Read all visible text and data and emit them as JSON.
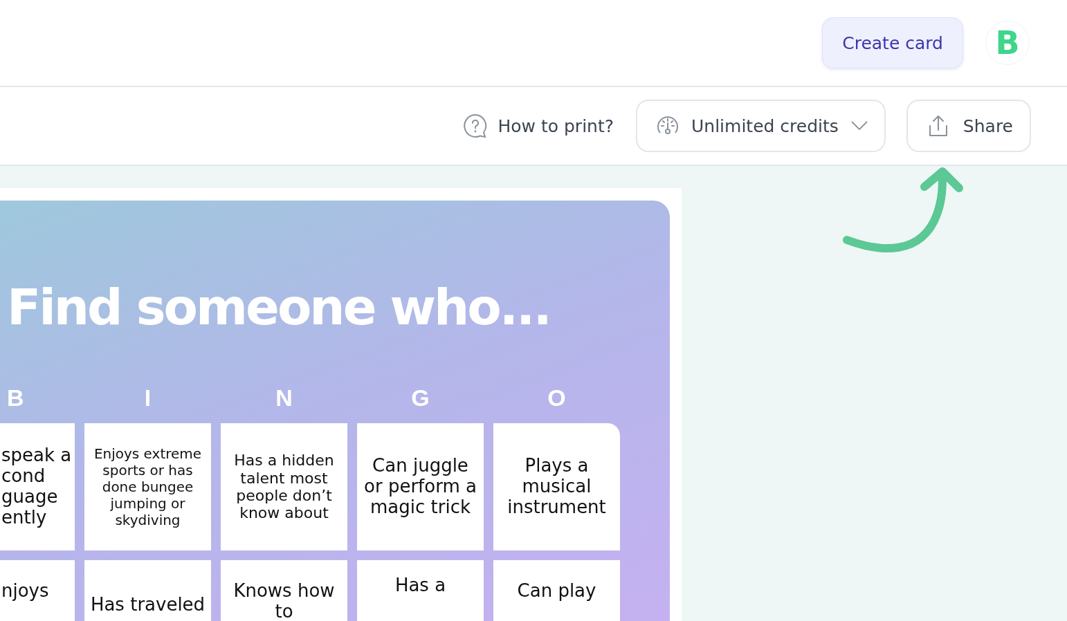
{
  "header": {
    "create_button": "Create card",
    "avatar_letter": "B"
  },
  "toolbar": {
    "help_link": "How to print?",
    "credits_dropdown": "Unlimited credits",
    "share_button": "Share"
  },
  "card": {
    "title": "Find someone who...",
    "columns": [
      "B",
      "I",
      "N",
      "G",
      "O"
    ],
    "rows": [
      [
        "speak a cond guage ently",
        "Enjoys extreme sports or has done bungee jumping or skydiving",
        "Has a hidden talent most people don’t know about",
        "Can juggle or perform a magic trick",
        "Plays a musical instrument"
      ],
      [
        "njoys",
        "Has traveled",
        "Knows how to",
        "Has a",
        "Can play"
      ]
    ]
  }
}
